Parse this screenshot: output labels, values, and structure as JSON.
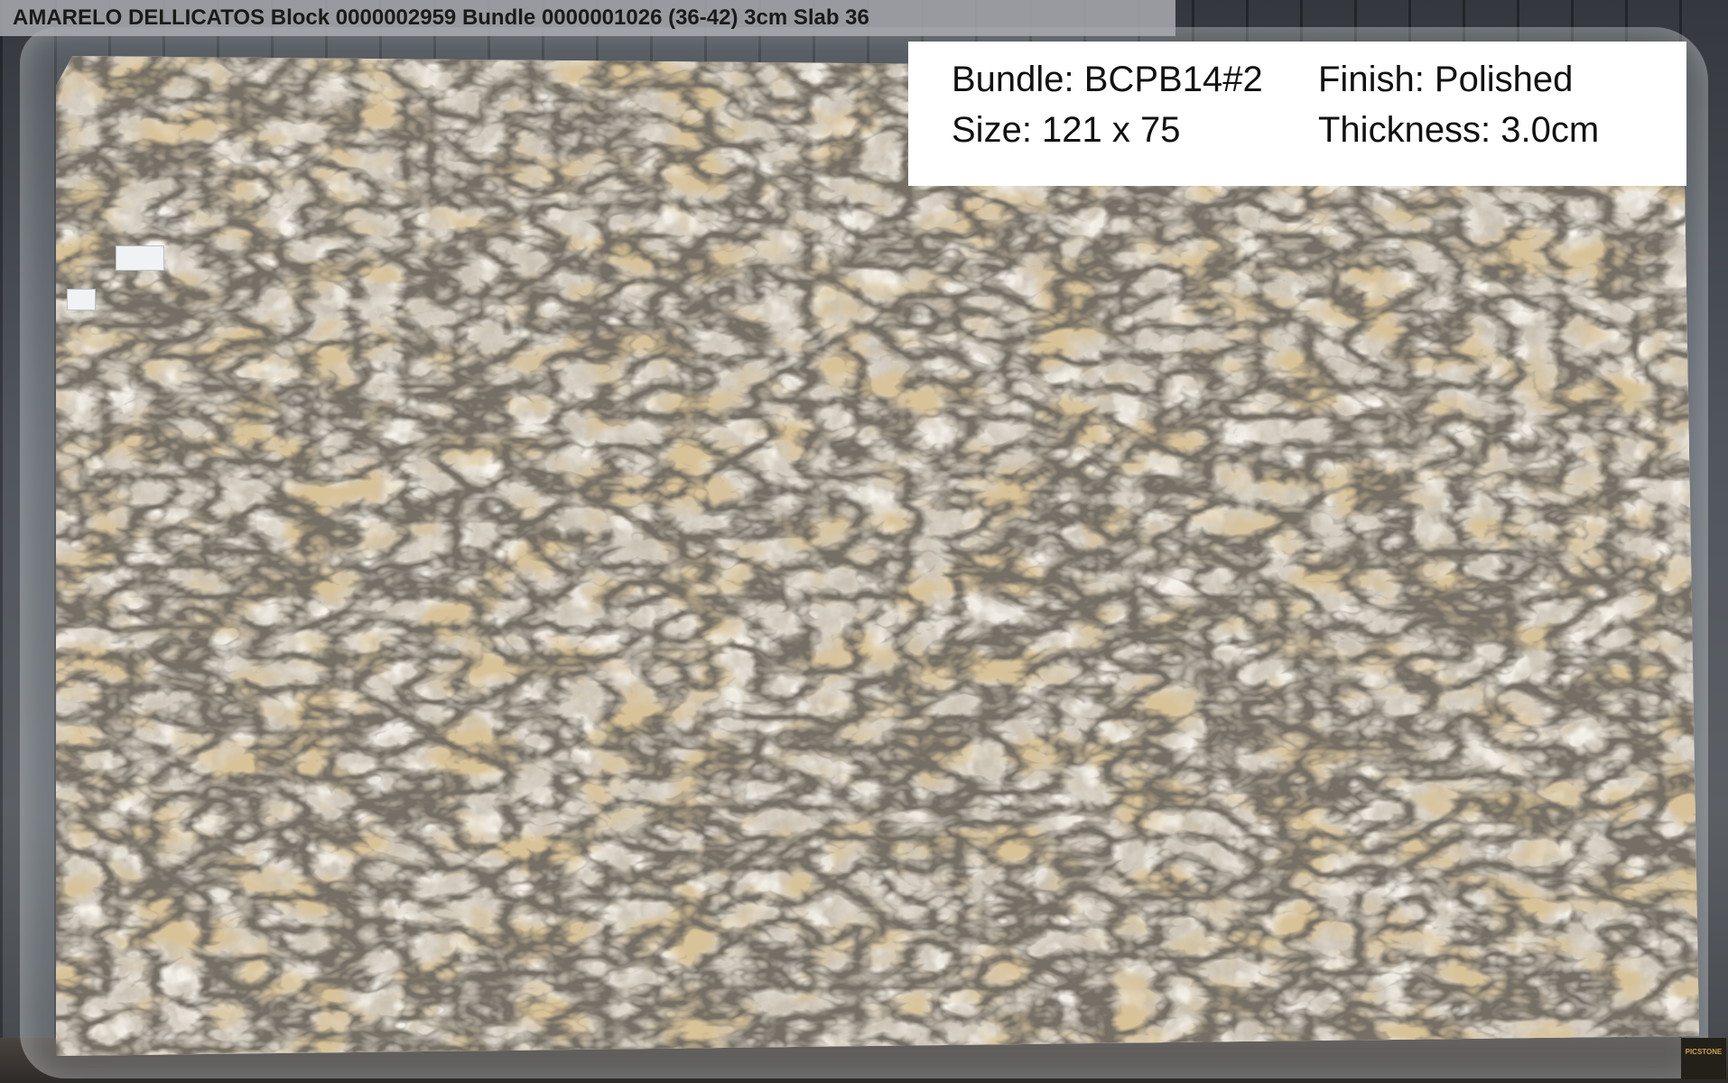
{
  "header": {
    "title": "AMARELO DELLICATOS Block 0000002959 Bundle 0000001026 (36-42) 3cm Slab 36"
  },
  "info": {
    "bundle": "Bundle: BCPB14#2",
    "size": "Size: 121 x 75",
    "finish": "Finish: Polished",
    "thickness": "Thickness: 3.0cm"
  },
  "logo": {
    "text": "PICSTONE"
  },
  "colors": {
    "slab_base": "#c9c1b3",
    "vein_dark": "#2f2a22",
    "vein_gold": "#b08a4e",
    "crystal_light": "#efe8da",
    "grey_patch": "#8f9296"
  }
}
